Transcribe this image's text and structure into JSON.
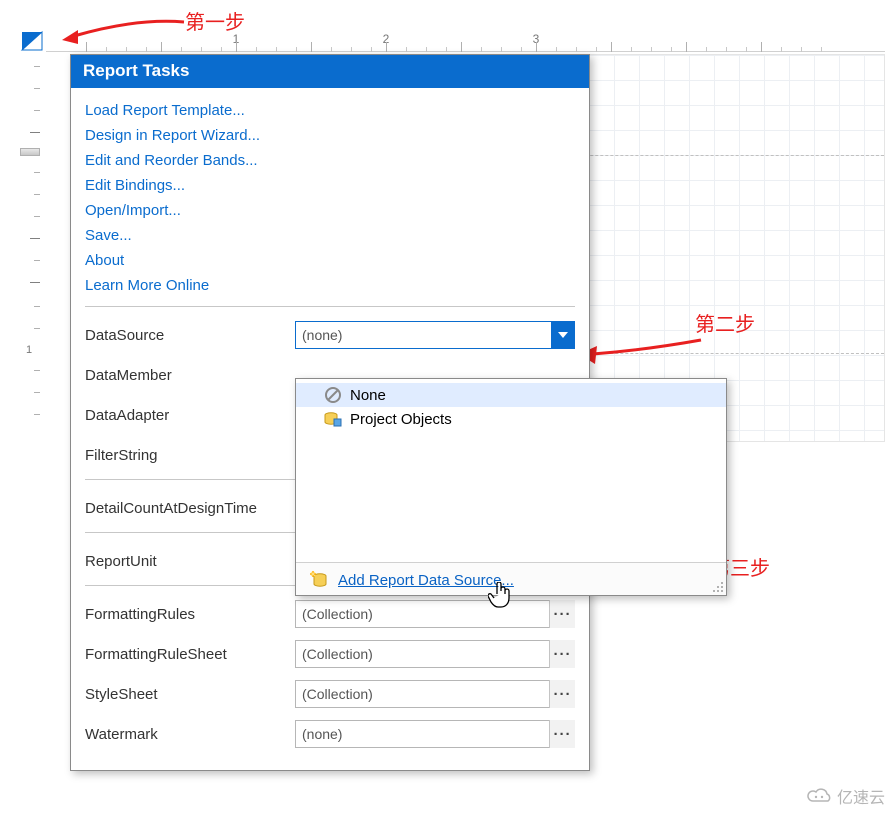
{
  "ruler": {
    "numbers": [
      "1",
      "2",
      "3"
    ]
  },
  "vruler": {
    "number": "1"
  },
  "panel": {
    "title": "Report Tasks",
    "links": [
      "Load Report Template...",
      "Design in Report Wizard...",
      "Edit and Reorder Bands...",
      "Edit Bindings...",
      "Open/Import...",
      "Save...",
      "About",
      "Learn More Online"
    ],
    "dataSource": {
      "label": "DataSource",
      "value": "(none)"
    },
    "dataMember": {
      "label": "DataMember"
    },
    "dataAdapter": {
      "label": "DataAdapter"
    },
    "filterString": {
      "label": "FilterString"
    },
    "detailCount": {
      "label": "DetailCountAtDesignTime"
    },
    "reportUnit": {
      "label": "ReportUnit"
    },
    "formattingRules": {
      "label": "FormattingRules",
      "value": "(Collection)"
    },
    "formattingRuleSheet": {
      "label": "FormattingRuleSheet",
      "value": "(Collection)"
    },
    "styleSheet": {
      "label": "StyleSheet",
      "value": "(Collection)"
    },
    "watermark": {
      "label": "Watermark",
      "value": "(none)"
    }
  },
  "dropdown": {
    "items": [
      {
        "label": "None",
        "icon": "none-icon",
        "selected": true
      },
      {
        "label": "Project Objects",
        "icon": "project-objects-icon",
        "selected": false
      }
    ],
    "addLink": "Add Report Data Source..."
  },
  "annotations": {
    "step1": "第一步",
    "step2": "第二步",
    "step3": "第三步"
  },
  "logo": "亿速云"
}
